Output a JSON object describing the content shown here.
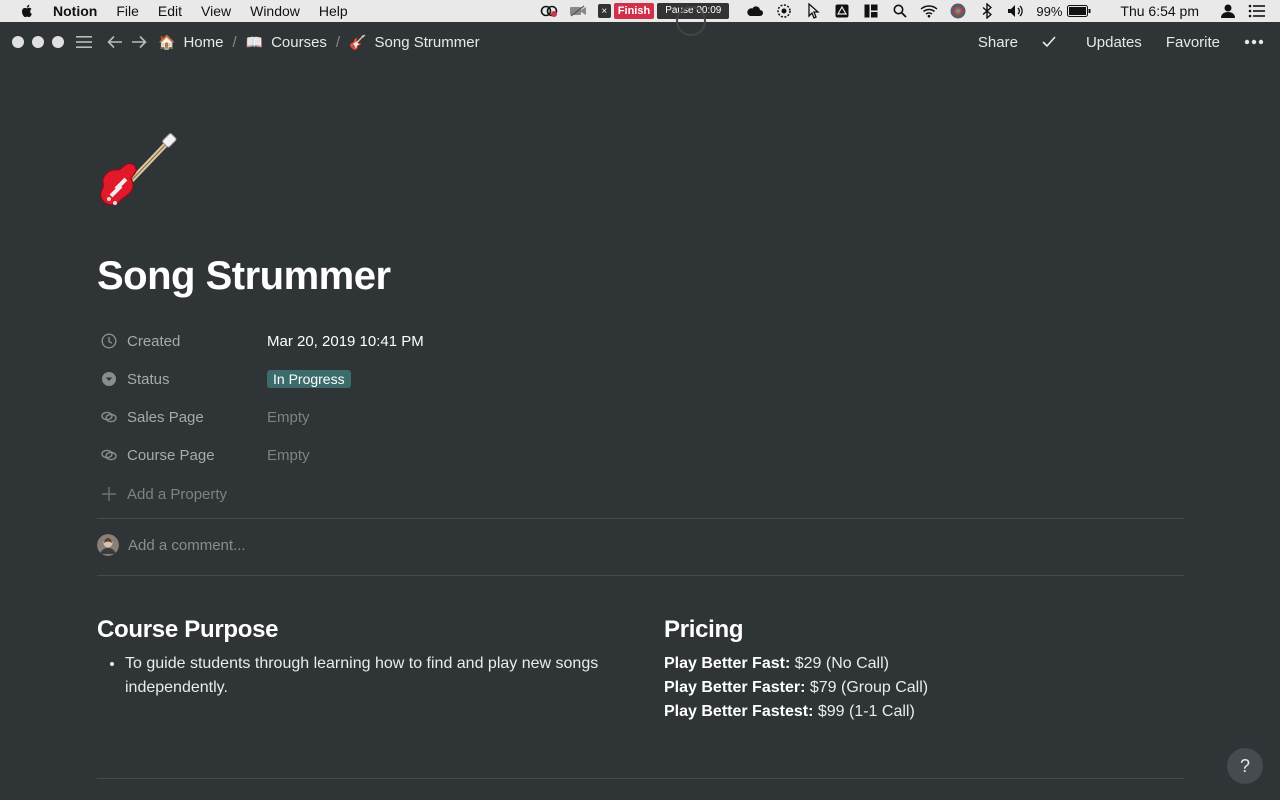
{
  "menubar": {
    "app_name": "Notion",
    "menus": [
      "File",
      "Edit",
      "View",
      "Window",
      "Help"
    ],
    "recorder": {
      "finish_label": "Finish",
      "pause_label": "Pause 00:09",
      "close_label": "×"
    },
    "battery": "99%",
    "clock": "Thu 6:54 pm"
  },
  "breadcrumb": {
    "items": [
      {
        "emoji": "🏠",
        "label": "Home"
      },
      {
        "emoji": "📖",
        "label": "Courses"
      },
      {
        "emoji": "🎸",
        "label": "Song Strummer"
      }
    ],
    "separator": "/"
  },
  "actions": {
    "share": "Share",
    "updates": "Updates",
    "favorite": "Favorite",
    "more": "•••"
  },
  "page": {
    "title": "Song Strummer",
    "properties": [
      {
        "label": "Created",
        "value": "Mar 20, 2019 10:41 PM",
        "icon": "clock-icon"
      },
      {
        "label": "Status",
        "value": "In Progress",
        "icon": "select-icon"
      },
      {
        "label": "Sales Page",
        "value": "Empty",
        "icon": "link-icon"
      },
      {
        "label": "Course Page",
        "value": "Empty",
        "icon": "link-icon"
      }
    ],
    "add_property": "Add a Property",
    "comment_placeholder": "Add a comment..."
  },
  "purpose": {
    "heading": "Course Purpose",
    "bullets": [
      "To guide students through learning how to find and play new songs independently."
    ]
  },
  "pricing": {
    "heading": "Pricing",
    "tiers": [
      {
        "name": "Play Better Fast:",
        "detail": "$29 (No Call)"
      },
      {
        "name": "Play Better Faster:",
        "detail": "$79 (Group Call)"
      },
      {
        "name": "Play Better Fastest:",
        "detail": "$99 (1-1 Call)"
      }
    ]
  },
  "help": "?",
  "colors": {
    "background": "#2f3437",
    "status_tag": "#3b6b6b",
    "menubar": "#e9e9e9",
    "recorder_finish": "#d0304a"
  }
}
